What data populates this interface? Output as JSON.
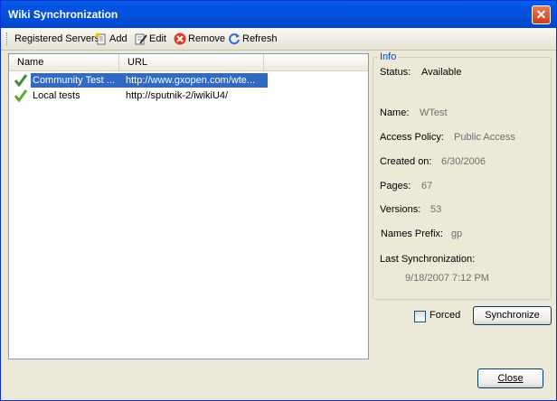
{
  "window": {
    "title": "Wiki Synchronization"
  },
  "toolbar": {
    "registered_servers": "Registered Servers",
    "add": "Add",
    "edit": "Edit",
    "remove": "Remove",
    "refresh": "Refresh"
  },
  "list": {
    "columns": [
      "Name",
      "URL"
    ],
    "rows": [
      {
        "name": "Community Test ...",
        "url": "http://www.gxopen.com/wte...",
        "selected": true
      },
      {
        "name": "Local tests",
        "url": "http://sputnik-2/iwikiU4/",
        "selected": false
      }
    ]
  },
  "info": {
    "legend": "Info",
    "status_label": "Status:",
    "status_value": "Available",
    "name_label": "Name:",
    "name_value": "WTest",
    "access_label": "Access Policy:",
    "access_value": "Public Access",
    "created_label": "Created on:",
    "created_value": "6/30/2006",
    "pages_label": "Pages:",
    "pages_value": "67",
    "versions_label": "Versions:",
    "versions_value": "53",
    "prefix_label": "Names Prefix:",
    "prefix_value": "gp",
    "lastsync_label": "Last Synchronization:",
    "lastsync_value": "9/18/2007 7:12 PM"
  },
  "controls": {
    "forced_label": "Forced",
    "forced_checked": false,
    "synchronize": "Synchronize",
    "close": "Close"
  },
  "colors": {
    "titlebar": "#0054E3",
    "selection": "#316AC5",
    "legend": "#0046D5"
  }
}
